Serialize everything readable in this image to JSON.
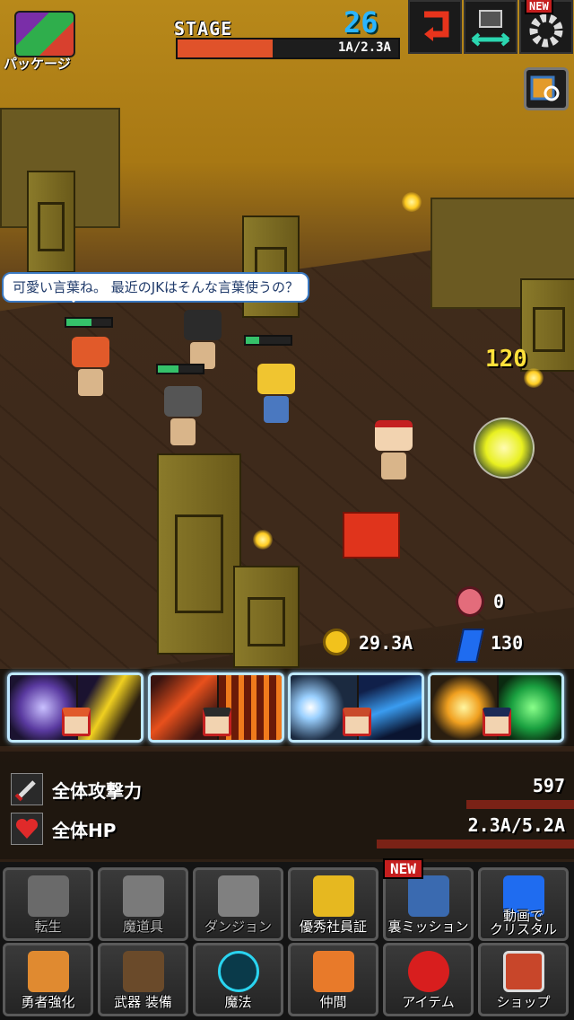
{
  "hud": {
    "package_label": "パッケージ",
    "stage_label": "STAGE",
    "stage_number": "26",
    "stage_progress_text": "1A/2.3A",
    "stage_progress_fraction": 0.43,
    "new_badge": "NEW"
  },
  "speech_bubble": "可愛い言葉ね。 最近のJKはそんな言葉使うの？",
  "damage_popup": "120",
  "resources": {
    "paw_count": "0",
    "gold": "29.3A",
    "crystal": "130"
  },
  "stats": {
    "attack_label": "全体攻撃力",
    "attack_value": "597",
    "hp_label": "全体HP",
    "hp_value": "2.3A/5.2A"
  },
  "menu": {
    "row1": [
      "転生",
      "魔道具",
      "ダンジョン",
      "優秀社員証",
      "裏ミッション",
      "動画で\nクリスタル"
    ],
    "row2": [
      "勇者強化",
      "武器 装備",
      "魔法",
      "仲間",
      "アイテム",
      "ショップ"
    ],
    "new_badge": "NEW"
  },
  "colors": {
    "stage_number": "#2bb5ff",
    "progress_fill": "#e0522a",
    "damage": "#ffe13a",
    "hp_bar": "#35c16a"
  },
  "icons": {
    "gold": "coin-icon",
    "crystal": "crystal-icon",
    "paw": "paw-icon",
    "attack": "sword-icon",
    "hp": "heart-icon",
    "settings": "gear-icon",
    "exchange": "rebirth-icon",
    "transport": "transport-icon"
  }
}
